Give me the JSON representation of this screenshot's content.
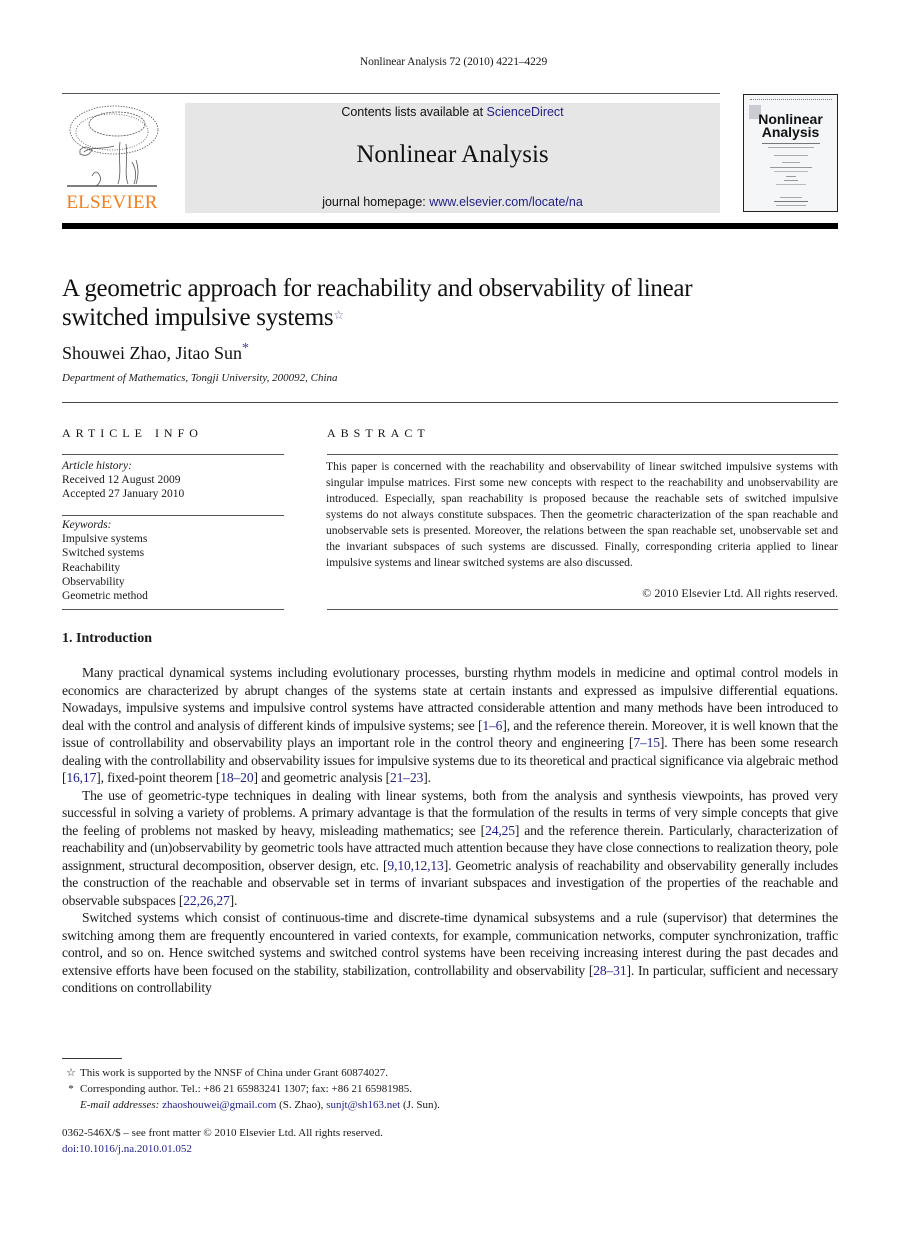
{
  "running_header": "Nonlinear Analysis 72 (2010) 4221–4229",
  "publisher": {
    "name": "ELSEVIER",
    "logo_icon": "elsevier-tree-logo",
    "brand_color": "#f07f1f"
  },
  "banner": {
    "contents_prefix": "Contents lists available at ",
    "contents_link": "ScienceDirect",
    "journal_title": "Nonlinear Analysis",
    "homepage_prefix": "journal homepage: ",
    "homepage_link": "www.elsevier.com/locate/na",
    "background": "#e6e6e6",
    "link_color": "#1f1f8a"
  },
  "cover": {
    "title_line1": "Nonlinear",
    "title_line2": "Analysis"
  },
  "article": {
    "title_line1": "A geometric approach for reachability and observability of linear",
    "title_line2": "switched impulsive systems",
    "title_mark": "☆",
    "authors": "Shouwei Zhao, Jitao Sun",
    "author_mark": "*",
    "affiliation": "Department of Mathematics, Tongji University, 200092, China"
  },
  "article_info": {
    "header": "ARTICLE INFO",
    "history_label": "Article history:",
    "received": "Received 12 August 2009",
    "accepted": "Accepted 27 January 2010",
    "keywords_label": "Keywords:",
    "keywords": [
      "Impulsive systems",
      "Switched systems",
      "Reachability",
      "Observability",
      "Geometric method"
    ]
  },
  "abstract": {
    "header": "ABSTRACT",
    "text": "This paper is concerned with the reachability and observability of linear switched impulsive systems with singular impulse matrices. First some new concepts with respect to the reachability and unobservability are introduced. Especially, span reachability is proposed because the reachable sets of switched impulsive systems do not always constitute subspaces. Then the geometric characterization of the span reachable and unobservable sets is presented. Moreover, the relations between the span reachable set, unobservable set and the invariant subspaces of such systems are discussed. Finally, corresponding criteria applied to linear impulsive systems and linear switched systems are also discussed.",
    "copyright": "© 2010 Elsevier Ltd. All rights reserved."
  },
  "introduction": {
    "heading": "1.  Introduction",
    "paragraphs": [
      [
        {
          "t": "Many practical dynamical systems including evolutionary processes, bursting rhythm models in medicine and optimal control models in economics are characterized by abrupt changes of the systems state at certain instants and expressed as impulsive differential equations. Nowadays, impulsive systems and impulsive control systems have attracted considerable attention and many methods have been introduced to deal with the control and analysis of different kinds of impulsive systems; see ["
        },
        {
          "ref": "1–6"
        },
        {
          "t": "], and the reference therein. Moreover, it is well known that the issue of controllability and observability plays an important role in the control theory and engineering ["
        },
        {
          "ref": "7–15"
        },
        {
          "t": "]. There has been some research dealing with the controllability and observability issues for impulsive systems due to its theoretical and practical significance via algebraic method ["
        },
        {
          "ref": "16,17"
        },
        {
          "t": "], fixed-point theorem ["
        },
        {
          "ref": "18–20"
        },
        {
          "t": "] and geometric analysis ["
        },
        {
          "ref": "21–23"
        },
        {
          "t": "]."
        }
      ],
      [
        {
          "t": "The use of geometric-type techniques in dealing with linear systems, both from the analysis and synthesis viewpoints, has proved very successful in solving a variety of problems. A primary advantage is that the formulation of the results in terms of very simple concepts that give the feeling of problems not masked by heavy, misleading mathematics; see ["
        },
        {
          "ref": "24,25"
        },
        {
          "t": "] and the reference therein. Particularly, characterization of reachability and (un)observability by geometric tools have attracted much attention because they have close connections to realization theory, pole assignment, structural decomposition, observer design, etc. ["
        },
        {
          "ref": "9,10,12,13"
        },
        {
          "t": "]. Geometric analysis of reachability and observability generally includes the construction of the reachable and observable set in terms of invariant subspaces and investigation of the properties of the reachable and observable subspaces ["
        },
        {
          "ref": "22,26,27"
        },
        {
          "t": "]."
        }
      ],
      [
        {
          "t": "Switched systems which consist of continuous-time and discrete-time dynamical subsystems and a rule (supervisor) that determines the switching among them are frequently encountered in varied contexts, for example, communication networks, computer synchronization, traffic control, and so on. Hence switched systems and switched control systems have been receiving increasing interest during the past decades and extensive efforts have been focused on the stability, stabilization, controllability and observability ["
        },
        {
          "ref": "28–31"
        },
        {
          "t": "]. In particular, sufficient and necessary conditions on controllability"
        }
      ]
    ]
  },
  "footnotes": {
    "funding_mark": "☆",
    "funding": "This work is supported by the NNSF of China under Grant 60874027.",
    "corr_mark": "*",
    "corresponding": "Corresponding author. Tel.: +86 21 65983241 1307; fax: +86 21 65981985.",
    "email_label": "E-mail addresses:",
    "email1": "zhaoshouwei@gmail.com",
    "email1_owner": " (S. Zhao), ",
    "email2": "sunjt@sh163.net",
    "email2_owner": " (J. Sun)."
  },
  "front_matter": {
    "issn_line": "0362-546X/$ – see front matter © 2010 Elsevier Ltd. All rights reserved.",
    "doi": "doi:10.1016/j.na.2010.01.052"
  }
}
